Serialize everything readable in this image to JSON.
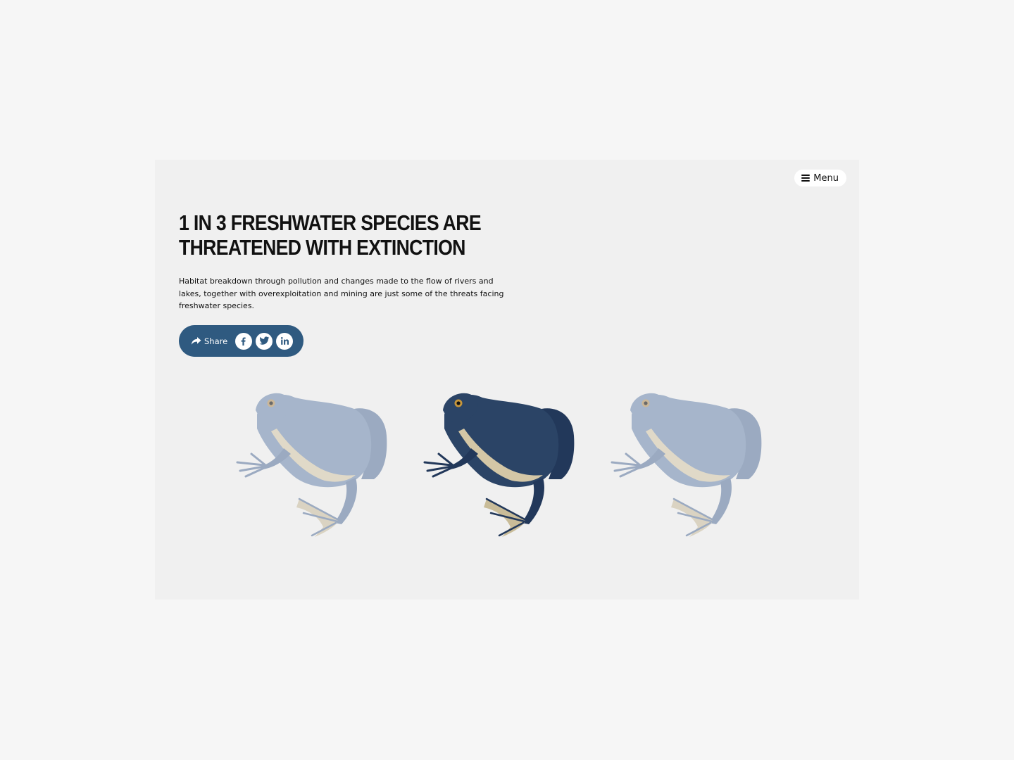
{
  "header": {
    "menu_label": "Menu",
    "menu_icon": "hamburger-icon"
  },
  "article": {
    "headline": "1 IN 3 FRESHWATER SPECIES ARE THREATENED WITH EXTINCTION",
    "intro": "Habitat breakdown through pollution and changes made to the flow of rivers and lakes, together with overexploitation and mining are just some of the threats facing freshwater species."
  },
  "share": {
    "label": "Share",
    "icon": "share-arrow-icon",
    "networks": [
      {
        "name": "Facebook",
        "icon": "facebook-icon"
      },
      {
        "name": "Twitter",
        "icon": "twitter-icon"
      },
      {
        "name": "LinkedIn",
        "icon": "linkedin-icon"
      }
    ],
    "color": "#2f5a80"
  },
  "illustration": {
    "frogs": [
      {
        "highlighted": false
      },
      {
        "highlighted": true
      },
      {
        "highlighted": false
      }
    ],
    "highlight_color": "#2b4466",
    "faded_color": "#6e86a8"
  }
}
